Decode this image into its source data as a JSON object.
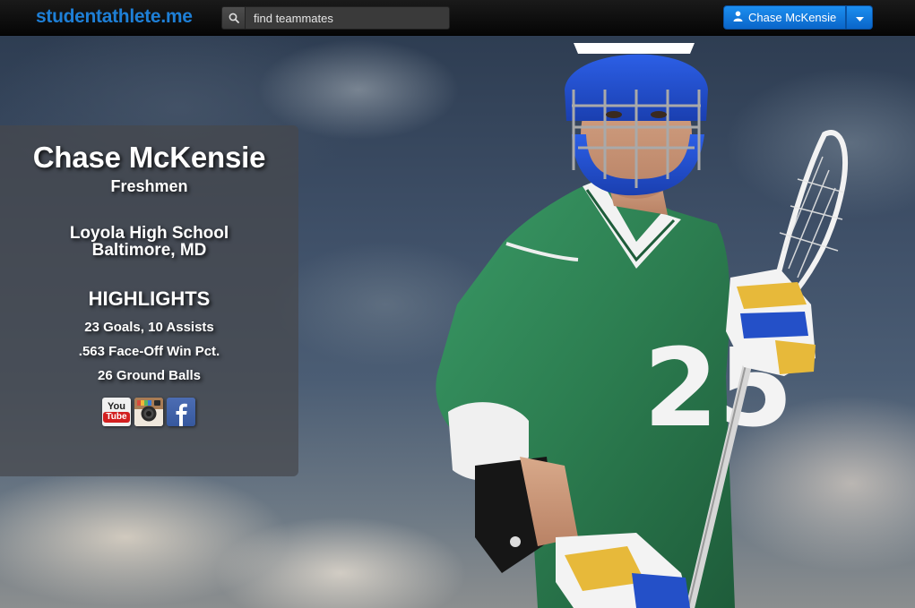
{
  "navbar": {
    "brand": "studentathlete.me",
    "search": {
      "value": "find teammates",
      "icon": "search-icon"
    },
    "user_menu": {
      "label": "Chase McKensie",
      "icon": "user-icon",
      "dropdown_icon": "caret-down-icon"
    }
  },
  "profile": {
    "name": "Chase McKensie",
    "class_year": "Freshmen",
    "school": "Loyola High School",
    "location": "Baltimore, MD",
    "highlights_heading": "HIGHLIGHTS",
    "highlights": [
      "23 Goals, 10 Assists",
      ".563 Face-Off Win Pct.",
      "26 Ground Balls"
    ],
    "social": [
      {
        "name": "YouTube",
        "icon": "youtube-icon",
        "you": "You",
        "tube": "Tube"
      },
      {
        "name": "Instagram",
        "icon": "instagram-icon"
      },
      {
        "name": "Facebook",
        "icon": "facebook-icon",
        "glyph": "f"
      }
    ]
  },
  "hero": {
    "jersey_number": "25"
  },
  "colors": {
    "brand": "#1e7fd6",
    "button_blue": "#0a65c9",
    "navbar_bg": "#0d0d0d",
    "jersey_green": "#2f8a57",
    "helmet_blue": "#1f4fd1"
  }
}
